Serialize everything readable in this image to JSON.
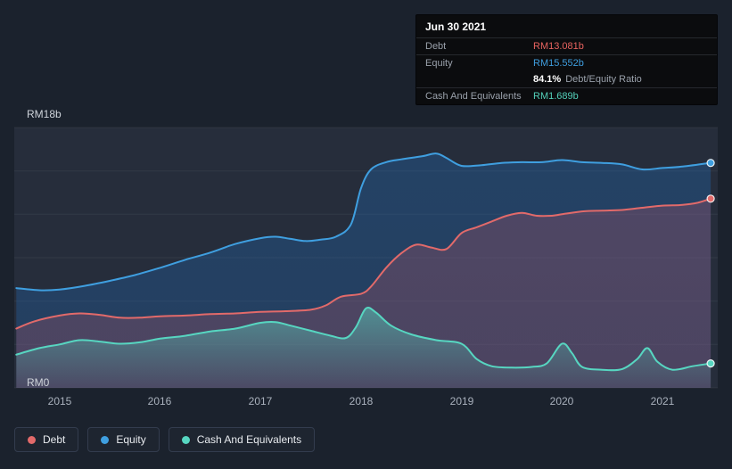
{
  "tooltip": {
    "title": "Jun 30 2021",
    "debt_label": "Debt",
    "debt_value": "RM13.081b",
    "equity_label": "Equity",
    "equity_value": "RM15.552b",
    "ratio_value": "84.1%",
    "ratio_label": "Debt/Equity Ratio",
    "cash_label": "Cash And Equivalents",
    "cash_value": "RM1.689b"
  },
  "axes": {
    "y_top": "RM18b",
    "y_bottom": "RM0"
  },
  "legend": [
    {
      "label": "Debt",
      "color": "#e26a6a"
    },
    {
      "label": "Equity",
      "color": "#3f9fe0"
    },
    {
      "label": "Cash And Equivalents",
      "color": "#57d6c1"
    }
  ],
  "colors": {
    "page_background": "#1b222d",
    "plot_background": "#262d3b",
    "tooltip_background": "#0b0c0e",
    "debt": "#e26a6a",
    "equity": "#3f9fe0",
    "cash": "#57d6c1"
  },
  "chart_data": {
    "type": "area",
    "x_range": [
      2014.55,
      2021.55
    ],
    "y_range": [
      0,
      18
    ],
    "y_unit": "RM billions",
    "y_gridlines": [
      0,
      3,
      6,
      9,
      12,
      15,
      18
    ],
    "x_ticks": [
      2015,
      2016,
      2017,
      2018,
      2019,
      2020,
      2021
    ],
    "series": [
      {
        "name": "Equity",
        "color": "#3f9fe0",
        "fill_top": "rgba(33,110,190,0.32)",
        "fill_bottom": "rgba(33,110,190,0.28)",
        "latest_label": "RM15.552b",
        "points": [
          [
            2014.57,
            6.9
          ],
          [
            2014.8,
            6.75
          ],
          [
            2015.0,
            6.8
          ],
          [
            2015.25,
            7.05
          ],
          [
            2015.5,
            7.4
          ],
          [
            2015.75,
            7.8
          ],
          [
            2016.0,
            8.3
          ],
          [
            2016.25,
            8.85
          ],
          [
            2016.5,
            9.35
          ],
          [
            2016.75,
            9.95
          ],
          [
            2017.0,
            10.35
          ],
          [
            2017.15,
            10.45
          ],
          [
            2017.3,
            10.3
          ],
          [
            2017.45,
            10.15
          ],
          [
            2017.6,
            10.25
          ],
          [
            2017.75,
            10.45
          ],
          [
            2017.9,
            11.3
          ],
          [
            2018.0,
            13.8
          ],
          [
            2018.1,
            15.1
          ],
          [
            2018.25,
            15.6
          ],
          [
            2018.4,
            15.8
          ],
          [
            2018.6,
            16.0
          ],
          [
            2018.75,
            16.2
          ],
          [
            2018.85,
            15.9
          ],
          [
            2019.0,
            15.35
          ],
          [
            2019.2,
            15.4
          ],
          [
            2019.4,
            15.55
          ],
          [
            2019.6,
            15.6
          ],
          [
            2019.8,
            15.6
          ],
          [
            2020.0,
            15.75
          ],
          [
            2020.2,
            15.6
          ],
          [
            2020.4,
            15.55
          ],
          [
            2020.6,
            15.45
          ],
          [
            2020.8,
            15.1
          ],
          [
            2021.0,
            15.2
          ],
          [
            2021.2,
            15.3
          ],
          [
            2021.48,
            15.552
          ]
        ]
      },
      {
        "name": "Debt",
        "color": "#e26a6a",
        "fill_top": "rgba(214,86,100,0.24)",
        "fill_bottom": "rgba(214,86,100,0.22)",
        "latest_label": "RM13.081b",
        "points": [
          [
            2014.57,
            4.1
          ],
          [
            2014.75,
            4.6
          ],
          [
            2015.0,
            5.0
          ],
          [
            2015.2,
            5.15
          ],
          [
            2015.4,
            5.05
          ],
          [
            2015.6,
            4.85
          ],
          [
            2015.8,
            4.85
          ],
          [
            2016.0,
            4.95
          ],
          [
            2016.25,
            5.0
          ],
          [
            2016.5,
            5.1
          ],
          [
            2016.75,
            5.15
          ],
          [
            2017.0,
            5.25
          ],
          [
            2017.25,
            5.3
          ],
          [
            2017.5,
            5.4
          ],
          [
            2017.65,
            5.7
          ],
          [
            2017.8,
            6.3
          ],
          [
            2018.0,
            6.5
          ],
          [
            2018.1,
            7.0
          ],
          [
            2018.25,
            8.3
          ],
          [
            2018.4,
            9.3
          ],
          [
            2018.55,
            9.9
          ],
          [
            2018.7,
            9.7
          ],
          [
            2018.85,
            9.6
          ],
          [
            2019.0,
            10.7
          ],
          [
            2019.15,
            11.1
          ],
          [
            2019.3,
            11.5
          ],
          [
            2019.45,
            11.9
          ],
          [
            2019.6,
            12.1
          ],
          [
            2019.75,
            11.9
          ],
          [
            2019.9,
            11.9
          ],
          [
            2020.0,
            12.0
          ],
          [
            2020.2,
            12.2
          ],
          [
            2020.4,
            12.25
          ],
          [
            2020.6,
            12.3
          ],
          [
            2020.8,
            12.45
          ],
          [
            2021.0,
            12.6
          ],
          [
            2021.2,
            12.65
          ],
          [
            2021.35,
            12.8
          ],
          [
            2021.48,
            13.081
          ]
        ]
      },
      {
        "name": "Cash And Equivalents",
        "color": "#57d6c1",
        "fill_top": "rgba(86,214,195,0.50)",
        "fill_bottom": "rgba(86,214,195,0.04)",
        "latest_label": "RM1.689b",
        "points": [
          [
            2014.57,
            2.3
          ],
          [
            2014.8,
            2.75
          ],
          [
            2015.0,
            3.0
          ],
          [
            2015.2,
            3.3
          ],
          [
            2015.4,
            3.2
          ],
          [
            2015.6,
            3.05
          ],
          [
            2015.8,
            3.15
          ],
          [
            2016.0,
            3.4
          ],
          [
            2016.25,
            3.6
          ],
          [
            2016.5,
            3.9
          ],
          [
            2016.75,
            4.1
          ],
          [
            2017.0,
            4.5
          ],
          [
            2017.15,
            4.55
          ],
          [
            2017.3,
            4.3
          ],
          [
            2017.5,
            3.95
          ],
          [
            2017.7,
            3.6
          ],
          [
            2017.85,
            3.45
          ],
          [
            2017.95,
            4.2
          ],
          [
            2018.05,
            5.5
          ],
          [
            2018.15,
            5.2
          ],
          [
            2018.3,
            4.3
          ],
          [
            2018.5,
            3.7
          ],
          [
            2018.75,
            3.3
          ],
          [
            2019.0,
            3.05
          ],
          [
            2019.15,
            2.0
          ],
          [
            2019.3,
            1.5
          ],
          [
            2019.5,
            1.4
          ],
          [
            2019.7,
            1.45
          ],
          [
            2019.85,
            1.7
          ],
          [
            2020.0,
            3.05
          ],
          [
            2020.1,
            2.4
          ],
          [
            2020.2,
            1.45
          ],
          [
            2020.4,
            1.25
          ],
          [
            2020.6,
            1.3
          ],
          [
            2020.75,
            2.0
          ],
          [
            2020.85,
            2.75
          ],
          [
            2020.95,
            1.8
          ],
          [
            2021.1,
            1.25
          ],
          [
            2021.3,
            1.5
          ],
          [
            2021.48,
            1.689
          ]
        ]
      }
    ]
  }
}
